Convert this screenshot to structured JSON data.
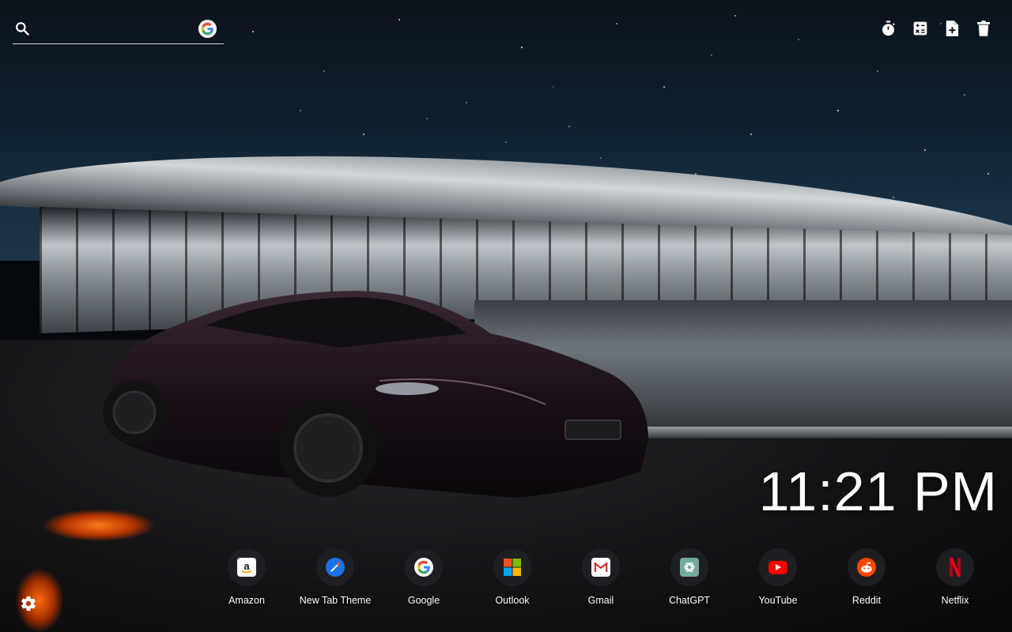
{
  "search": {
    "placeholder": "",
    "value": "",
    "engine_icon": "google-g-icon"
  },
  "toolbar": {
    "icons": [
      "timer-icon",
      "calculator-icon",
      "add-note-icon",
      "trash-icon"
    ]
  },
  "clock": {
    "time": "11:21 PM"
  },
  "shortcuts": [
    {
      "label": "Amazon",
      "icon": "amazon-icon"
    },
    {
      "label": "New Tab Theme",
      "icon": "new-tab-theme-icon"
    },
    {
      "label": "Google",
      "icon": "google-icon"
    },
    {
      "label": "Outlook",
      "icon": "outlook-icon"
    },
    {
      "label": "Gmail",
      "icon": "gmail-icon"
    },
    {
      "label": "ChatGPT",
      "icon": "chatgpt-icon"
    },
    {
      "label": "YouTube",
      "icon": "youtube-icon"
    },
    {
      "label": "Reddit",
      "icon": "reddit-icon"
    },
    {
      "label": "Netflix",
      "icon": "netflix-icon"
    }
  ],
  "settings": {
    "icon": "gear-icon"
  },
  "colors": {
    "accent_white": "#ffffff",
    "shortcut_bg": "#202124",
    "youtube_red": "#ff0000",
    "netflix_red": "#e50914",
    "reddit_orange": "#ff4500"
  }
}
